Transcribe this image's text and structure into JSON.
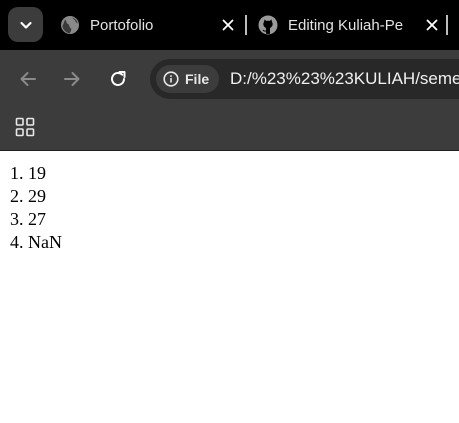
{
  "tabs": [
    {
      "title": "Portofolio",
      "favicon": "globe-icon"
    },
    {
      "title": "Editing Kuliah-Pe",
      "favicon": "github-icon"
    }
  ],
  "toolbar": {
    "site_chip_label": "File",
    "url": "D:/%23%23%23KULIAH/seme"
  },
  "page": {
    "results": [
      {
        "index": "1.",
        "value": "19"
      },
      {
        "index": "2.",
        "value": "29"
      },
      {
        "index": "3.",
        "value": "27"
      },
      {
        "index": "4.",
        "value": "NaN"
      }
    ]
  },
  "colors": {
    "tabstrip_bg": "#000000",
    "toolbar_bg": "#3c3c3c",
    "omnibox_bg": "#282828",
    "page_bg": "#ffffff"
  }
}
